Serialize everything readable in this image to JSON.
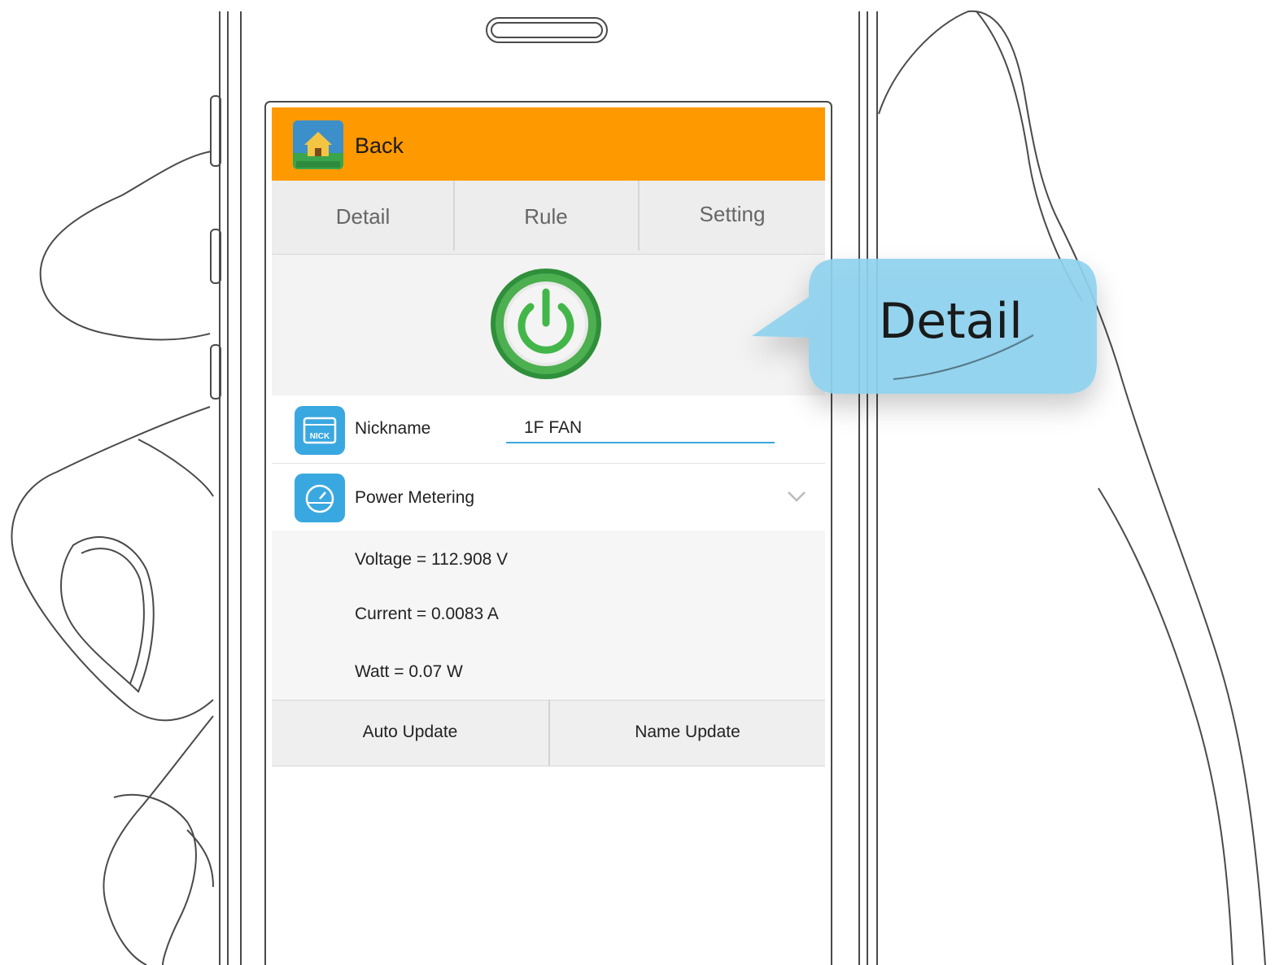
{
  "header": {
    "back_label": "Back",
    "app_icon": "smart-home-app-icon"
  },
  "tabs": [
    {
      "label": "Detail"
    },
    {
      "label": "Rule"
    },
    {
      "label": "Setting"
    }
  ],
  "power": {
    "icon": "power-icon",
    "color": "#4caf50"
  },
  "nickname": {
    "label": "Nickname",
    "value": "1F FAN",
    "icon": "nick-icon"
  },
  "power_metering": {
    "label": "Power Metering",
    "icon": "gauge-icon",
    "voltage": "Voltage = 112.908 V",
    "current": "Current = 0.0083 A",
    "watt": "Watt = 0.07 W"
  },
  "buttons": {
    "auto_update": "Auto Update",
    "name_update": "Name Update"
  },
  "callout": {
    "text": "Detail",
    "color": "#8fd2ef"
  },
  "colors": {
    "header": "#ff9900",
    "accent": "#3aa8e0"
  }
}
